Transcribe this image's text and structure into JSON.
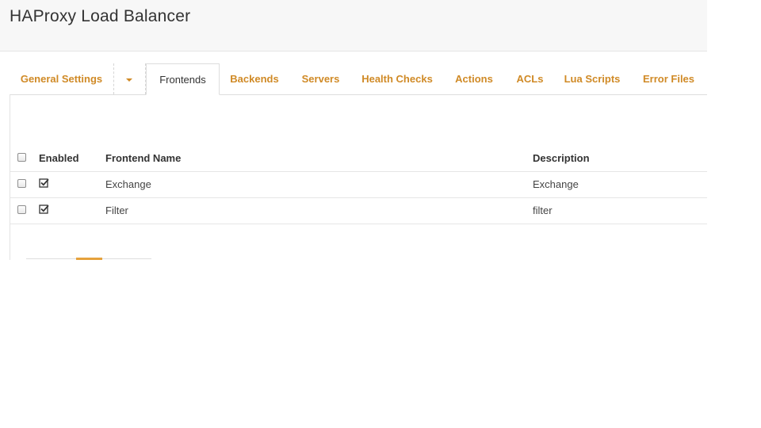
{
  "header": {
    "title": "HAProxy Load Balancer"
  },
  "tabs": [
    {
      "label": "General Settings"
    },
    {
      "label": "Frontends",
      "active": true
    },
    {
      "label": "Backends"
    },
    {
      "label": "Servers"
    },
    {
      "label": "Health Checks"
    },
    {
      "label": "Actions"
    },
    {
      "label": "ACLs"
    },
    {
      "label": "Lua Scripts"
    },
    {
      "label": "Error Files"
    }
  ],
  "table": {
    "columns": {
      "enabled": "Enabled",
      "name": "Frontend Name",
      "description": "Description"
    },
    "rows": [
      {
        "enabled": true,
        "name": "Exchange",
        "description": "Exchange"
      },
      {
        "enabled": true,
        "name": "Filter",
        "description": "filter"
      }
    ]
  },
  "icons": {
    "dropdown": "caret-down-icon",
    "enabled": "checkbox-checked-icon"
  },
  "colors": {
    "accent": "#d08a26",
    "header_bg": "#f7f7f7"
  }
}
